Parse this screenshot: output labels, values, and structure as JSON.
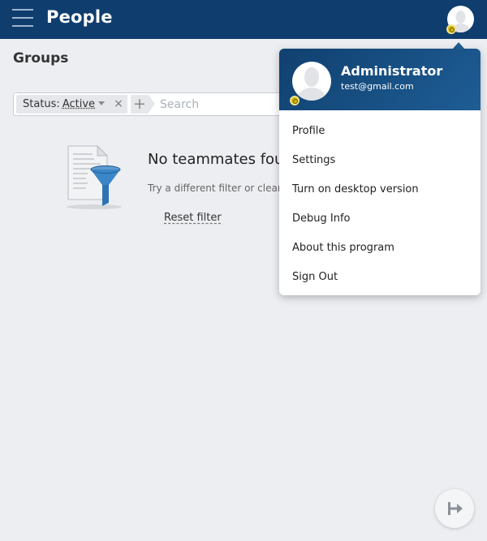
{
  "header": {
    "title": "People"
  },
  "section": {
    "title": "Groups"
  },
  "filter": {
    "status_label": "Status:",
    "status_value": "Active",
    "clear_icon": "×",
    "add_icon": "+",
    "search_placeholder": "Search"
  },
  "empty_state": {
    "title": "No teammates found",
    "subtitle": "Try a different filter or clear it",
    "reset_label": "Reset filter"
  },
  "profile_menu": {
    "name": "Administrator",
    "email": "test@gmail.com",
    "items": [
      {
        "label": "Profile"
      },
      {
        "label": "Settings"
      },
      {
        "label": "Turn on desktop version"
      },
      {
        "label": "Debug Info"
      },
      {
        "label": "About this program"
      },
      {
        "label": "Sign Out"
      }
    ]
  },
  "colors": {
    "header_bg": "#0f3d6e",
    "badge": "#d4b500",
    "page_bg": "#eceef1"
  },
  "icons": [
    "menu-icon",
    "avatar",
    "chevron-down-icon",
    "close-icon",
    "plus-icon",
    "filter-funnel-icon",
    "exit-icon"
  ]
}
